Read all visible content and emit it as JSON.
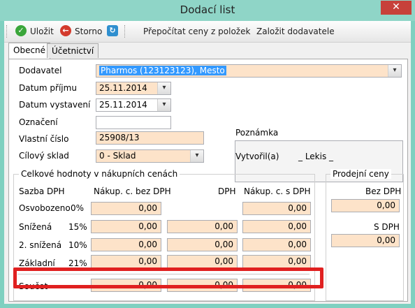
{
  "window": {
    "title": "Dodací list",
    "close_glyph": "✕"
  },
  "toolbar": {
    "save_label": "Uložit",
    "cancel_label": "Storno",
    "recalc_label": "Přepočítat ceny z položek",
    "create_supplier_label": "Založit dodavatele"
  },
  "tabs": [
    "Obecné",
    "Účetnictví"
  ],
  "form": {
    "supplier_label": "Dodavatel",
    "supplier_value": "Pharmos (123123123), Mesto",
    "receipt_date_label": "Datum příjmu",
    "receipt_date_value": "25.11.2014",
    "issue_date_label": "Datum vystavení",
    "issue_date_value": "25.11.2014",
    "designation_label": "Označení",
    "designation_value": "",
    "own_number_label": "Vlastní číslo",
    "own_number_value": "25908/13",
    "target_store_label": "Cílový sklad",
    "target_store_value": "0 - Sklad",
    "note_label": "Poznámka",
    "created_by_label": "Vytvořil(a)",
    "created_by_value": "_ Lekis _"
  },
  "totals": {
    "group_title": "Celkové hodnoty v nákupních cenách",
    "col_rate": "Sazba DPH",
    "col_net": "Nákup. c. bez DPH",
    "col_vat": "DPH",
    "col_gross": "Nákup. c. s DPH",
    "rows": [
      {
        "name": "Osvobozeno",
        "pct": "0%",
        "net": "0,00",
        "vat": "",
        "gross": "0,00"
      },
      {
        "name": "Snížená",
        "pct": "15%",
        "net": "0,00",
        "vat": "0,00",
        "gross": "0,00"
      },
      {
        "name": "2. snížená",
        "pct": "10%",
        "net": "0,00",
        "vat": "0,00",
        "gross": "0,00"
      },
      {
        "name": "Základní",
        "pct": "21%",
        "net": "0,00",
        "vat": "0,00",
        "gross": "0,00"
      }
    ],
    "sum_label": "Součet",
    "sum_net": "0,00",
    "sum_vat": "0,00",
    "sum_gross": "0,00"
  },
  "sale": {
    "group_title": "Prodejní ceny",
    "net_label": "Bez DPH",
    "net_value": "0,00",
    "gross_label": "S DPH",
    "gross_value": "0,00"
  },
  "icons": {
    "save": "check-icon",
    "cancel": "back-arrow-icon",
    "refresh": "refresh-icon",
    "dropdown": "chevron-down-icon"
  },
  "colors": {
    "field_bg": "#fde3c9",
    "highlight": "#e02020",
    "window_frame": "#8fd5c7"
  }
}
